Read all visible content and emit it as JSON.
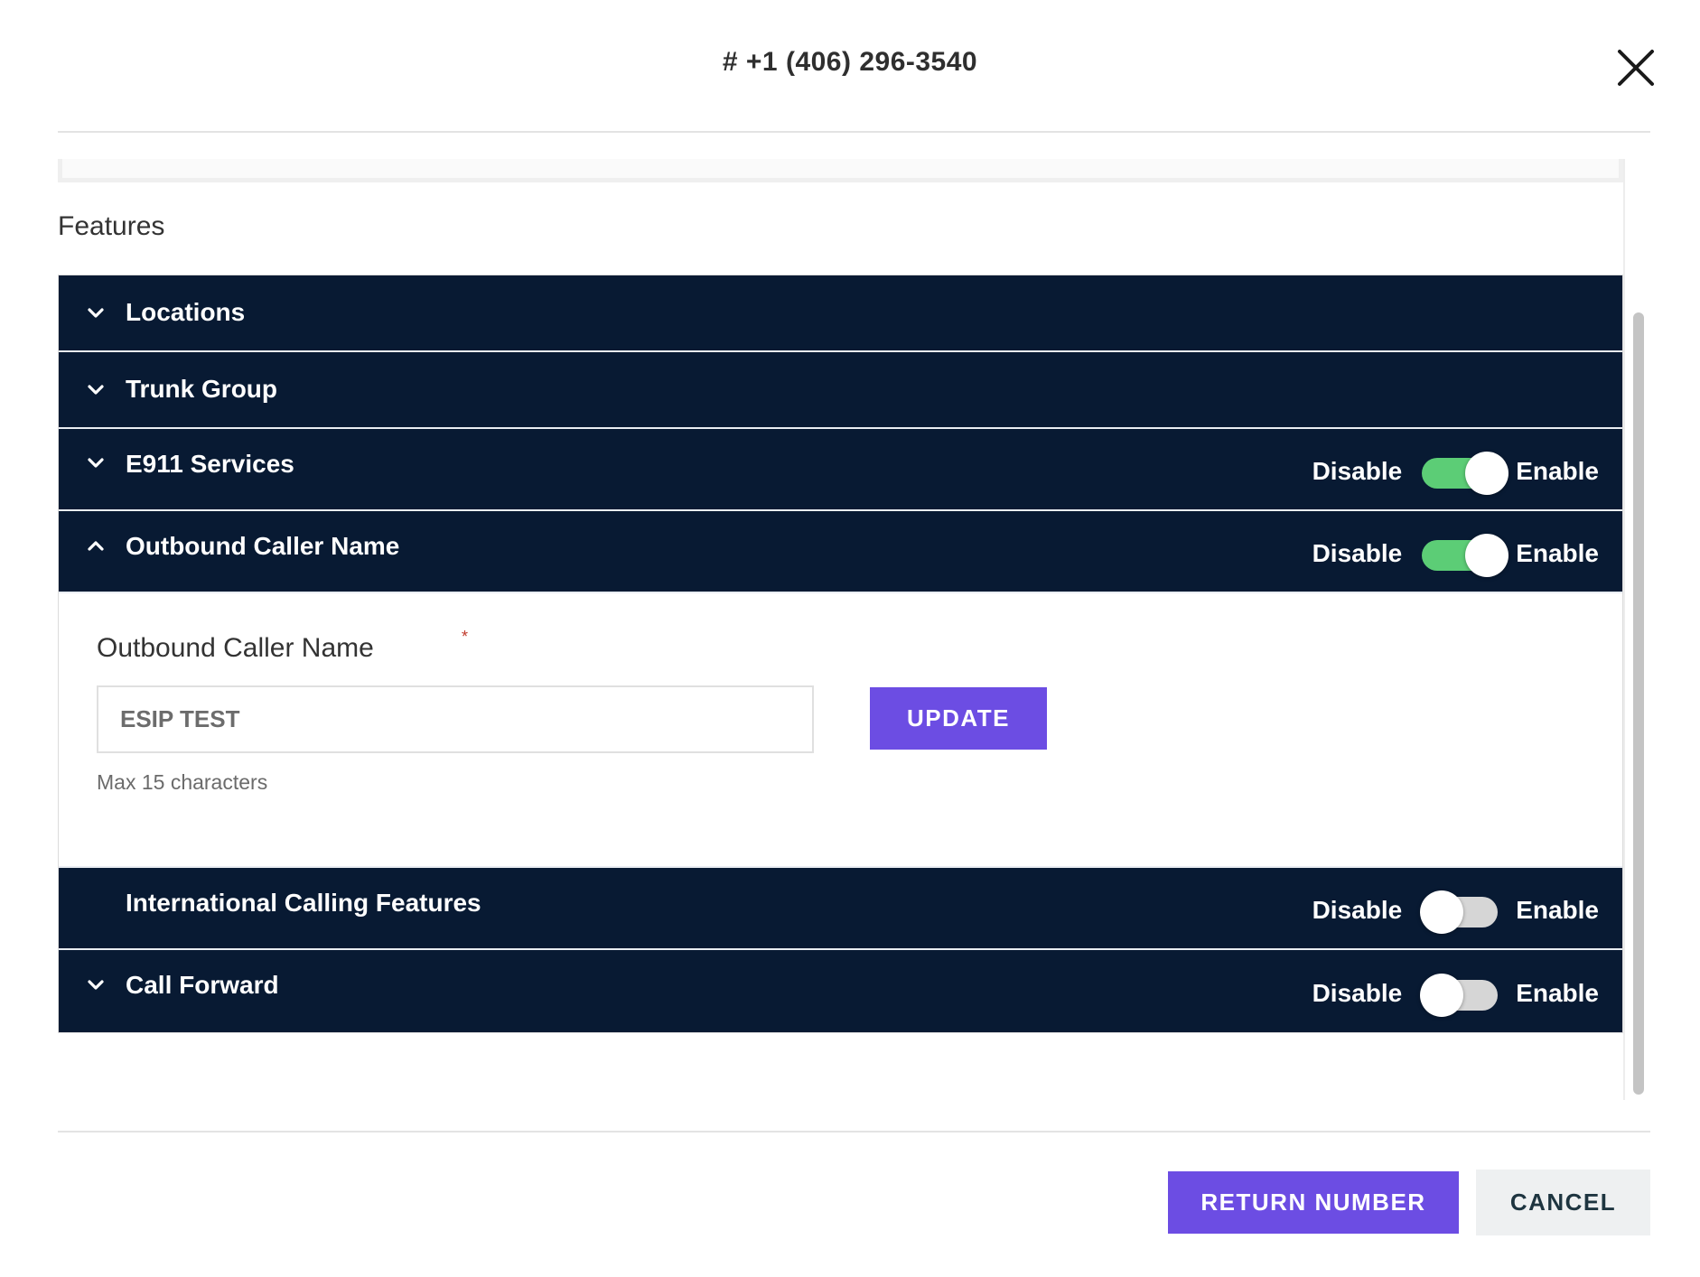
{
  "modal": {
    "title": "# +1 (406) 296-3540",
    "close_icon": "close-icon"
  },
  "features": {
    "title": "Features",
    "sections": [
      {
        "label": "Locations",
        "chevron": "chevron-down-icon"
      },
      {
        "label": "Trunk Group",
        "chevron": "chevron-down-icon"
      },
      {
        "label": "E911 Services",
        "chevron": "chevron-down-icon",
        "toggle": {
          "off_label": "Disable",
          "on_label": "Enable",
          "enabled": true
        }
      },
      {
        "label": "Outbound Caller Name",
        "chevron": "chevron-up-icon",
        "expanded": true,
        "toggle": {
          "off_label": "Disable",
          "on_label": "Enable",
          "enabled": true
        }
      },
      {
        "label": "International Calling Features",
        "toggle": {
          "off_label": "Disable",
          "on_label": "Enable",
          "enabled": false
        }
      },
      {
        "label": "Call Forward",
        "chevron": "chevron-down-icon",
        "toggle": {
          "off_label": "Disable",
          "on_label": "Enable",
          "enabled": false
        }
      }
    ],
    "outbound_caller_name_form": {
      "field_label": "Outbound Caller Name",
      "required_marker": "*",
      "value": "ESIP TEST",
      "helper": "Max 15 characters",
      "update_label": "UPDATE"
    }
  },
  "footer": {
    "return_label": "RETURN NUMBER",
    "cancel_label": "CANCEL"
  },
  "colors": {
    "section_header_bg": "#081a33",
    "primary_button": "#6c4de3",
    "toggle_on": "#5ccd76",
    "toggle_off": "#d6d6d6",
    "required_star": "#c0392b"
  }
}
